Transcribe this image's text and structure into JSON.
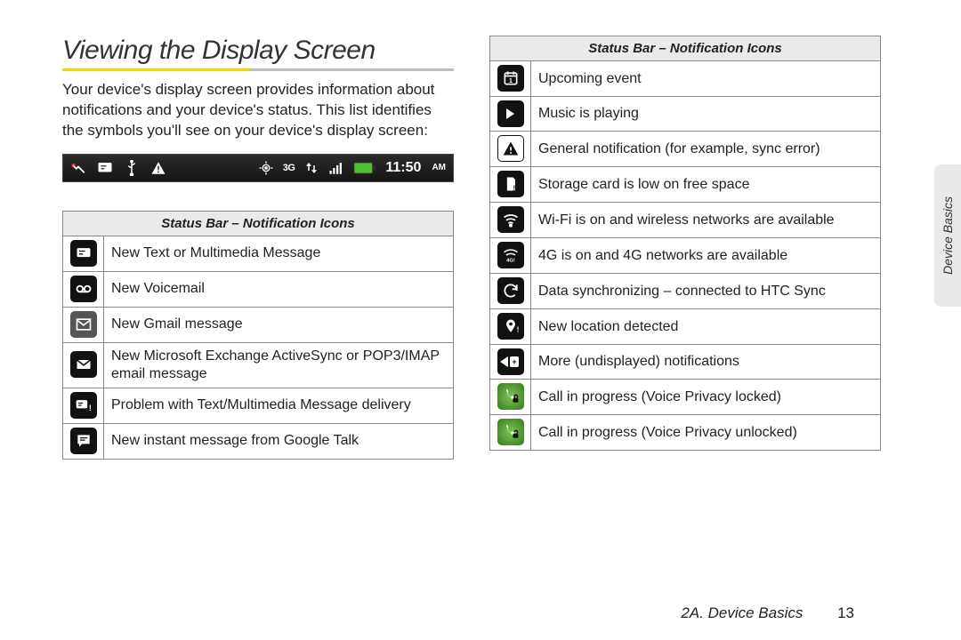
{
  "heading": "Viewing the Display Screen",
  "intro": "Your device's display screen provides information about notifications and your device's status. This list identifies the symbols you'll see on your device's display screen:",
  "statusbar": {
    "time": "11:50",
    "ampm": "AM",
    "net_label": "3G"
  },
  "tables": {
    "header": "Status Bar – Notification Icons",
    "left_rows": [
      {
        "icon": "sms-icon",
        "text": "New Text or Multimedia Message"
      },
      {
        "icon": "voicemail-icon",
        "text": "New Voicemail"
      },
      {
        "icon": "gmail-icon",
        "text": "New Gmail message"
      },
      {
        "icon": "mail-icon",
        "text": "New Microsoft Exchange ActiveSync or POP3/IMAP email message"
      },
      {
        "icon": "sms-error-icon",
        "text": "Problem with Text/Multimedia Message delivery"
      },
      {
        "icon": "chat-icon",
        "text": "New instant message from Google Talk"
      }
    ],
    "right_rows": [
      {
        "icon": "calendar-icon",
        "text": "Upcoming event"
      },
      {
        "icon": "play-icon",
        "text": "Music is playing"
      },
      {
        "icon": "warning-icon",
        "text": "General notification (for example, sync error)"
      },
      {
        "icon": "sdcard-low-icon",
        "text": "Storage card is low on free space"
      },
      {
        "icon": "wifi-avail-icon",
        "text": "Wi-Fi is on and wireless networks are available"
      },
      {
        "icon": "fourg-avail-icon",
        "text": "4G is on and 4G networks are available"
      },
      {
        "icon": "sync-icon",
        "text": "Data synchronizing – connected to HTC Sync"
      },
      {
        "icon": "location-icon",
        "text": "New location detected"
      },
      {
        "icon": "more-notif-icon",
        "text": "More (undisplayed) notifications"
      },
      {
        "icon": "call-locked-icon",
        "text": "Call in progress (Voice Privacy locked)"
      },
      {
        "icon": "call-unlocked-icon",
        "text": "Call in progress (Voice Privacy unlocked)"
      }
    ]
  },
  "footer": {
    "section": "2A. Device Basics",
    "page": "13"
  },
  "sidetab": "Device Basics"
}
